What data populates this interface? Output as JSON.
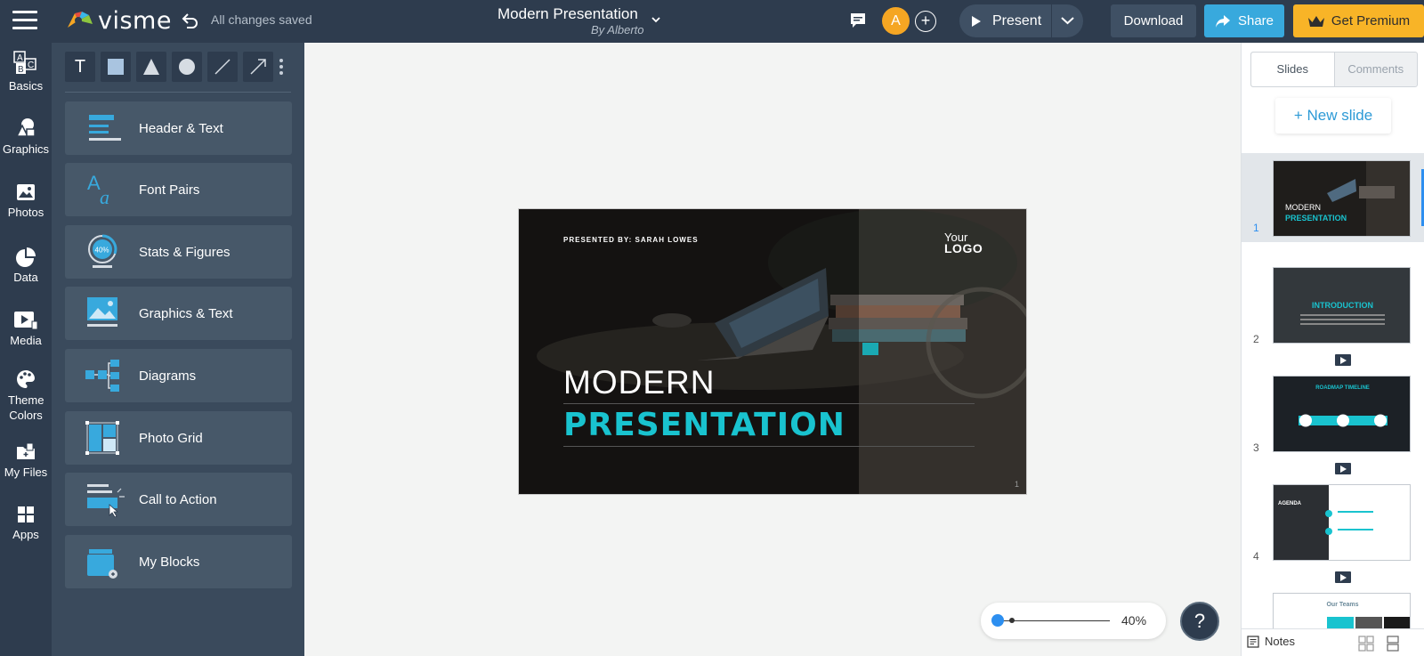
{
  "topbar": {
    "brand": "visme",
    "save_status": "All changes saved",
    "doc_title": "Modern Presentation",
    "doc_author": "By Alberto",
    "avatar_initial": "A",
    "add_collaborator": "+",
    "present_label": "Present",
    "download_label": "Download",
    "share_label": "Share",
    "premium_label": "Get Premium",
    "colors": {
      "bar": "#2e3c4e",
      "share": "#38a9dd",
      "premium": "#f8b427",
      "avatar": "#f5a623"
    }
  },
  "rail": {
    "items": [
      {
        "label": "Basics",
        "icon": "abc-blocks-icon"
      },
      {
        "label": "Graphics",
        "icon": "shapes-icon"
      },
      {
        "label": "Photos",
        "icon": "image-icon"
      },
      {
        "label": "Data",
        "icon": "pie-chart-icon"
      },
      {
        "label": "Media",
        "icon": "media-icon"
      },
      {
        "label": "Theme Colors",
        "icon": "palette-icon"
      },
      {
        "label": "My Files",
        "icon": "folder-plus-icon"
      },
      {
        "label": "Apps",
        "icon": "apps-grid-icon"
      }
    ]
  },
  "tools": {
    "text_tool": "T",
    "items": [
      "text-tool",
      "rectangle-tool",
      "triangle-tool",
      "circle-tool",
      "line-tool",
      "arrow-tool"
    ]
  },
  "blocks": {
    "items": [
      {
        "label": "Header & Text",
        "icon": "header-text-icon"
      },
      {
        "label": "Font Pairs",
        "icon": "font-pairs-icon"
      },
      {
        "label": "Stats & Figures",
        "icon": "stats-icon",
        "badge": "40%"
      },
      {
        "label": "Graphics & Text",
        "icon": "graphics-text-icon"
      },
      {
        "label": "Diagrams",
        "icon": "diagram-icon"
      },
      {
        "label": "Photo Grid",
        "icon": "photo-grid-icon"
      },
      {
        "label": "Call to Action",
        "icon": "call-to-action-icon"
      },
      {
        "label": "My Blocks",
        "icon": "my-blocks-icon"
      }
    ]
  },
  "slide": {
    "presented_by": "PRESENTED BY: SARAH LOWES",
    "logo_top": "Your",
    "logo_bottom": "LOGO",
    "title_line1": "MODERN",
    "title_line2": "PRESENTATION",
    "page_number": "1",
    "accent": "#19c3cf"
  },
  "zoom": {
    "value_label": "40%",
    "level": 0.4
  },
  "help": {
    "label": "?"
  },
  "right_panel": {
    "tabs": [
      "Slides",
      "Comments"
    ],
    "active_tab": "Slides",
    "new_slide_label": "+ New slide",
    "thumbs": [
      {
        "number": "1",
        "title_top": "MODERN",
        "title_bottom": "PRESENTATION",
        "selected": true
      },
      {
        "number": "2",
        "title": "INTRODUCTION"
      },
      {
        "number": "3",
        "title": "ROADMAP TIMELINE"
      },
      {
        "number": "4",
        "title": "AGENDA"
      },
      {
        "number": "",
        "title": "Our Teams"
      }
    ],
    "notes_label": "Notes"
  }
}
